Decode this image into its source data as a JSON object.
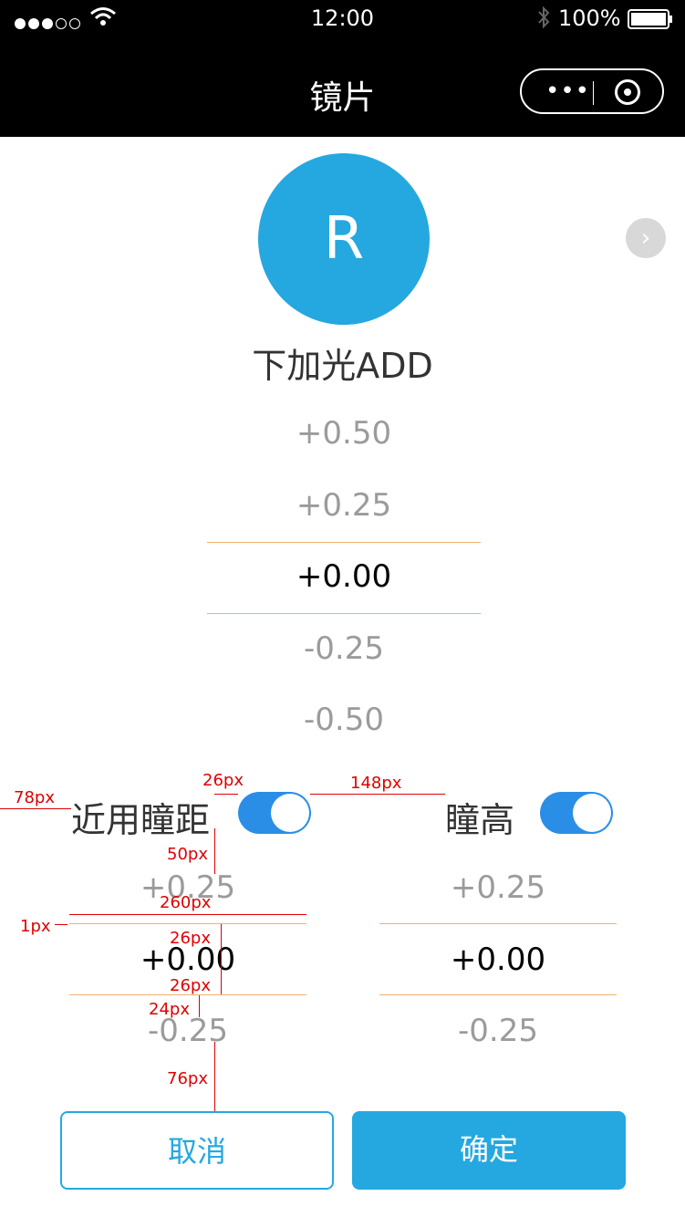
{
  "status": {
    "time": "12:00",
    "battery": "100%"
  },
  "nav": {
    "title": "镜片",
    "more_icon": "more-dots-icon",
    "close_icon": "target-icon"
  },
  "badge": {
    "letter": "R"
  },
  "heading": "下加光ADD",
  "add_picker": {
    "options": [
      "+0.50",
      "+0.25",
      "+0.00",
      "-0.25",
      "-0.50"
    ],
    "selected": "+0.00"
  },
  "near_pd": {
    "label": "近用瞳距",
    "toggle_on": true,
    "options": [
      "+0.25",
      "+0.00",
      "-0.25"
    ],
    "selected": "+0.00"
  },
  "pupil_height": {
    "label": "瞳高",
    "toggle_on": true,
    "options": [
      "+0.25",
      "+0.00",
      "-0.25"
    ],
    "selected": "+0.00"
  },
  "annotations": [
    "78px",
    "26px",
    "148px",
    "50px",
    "260px",
    "1px",
    "26px",
    "26px",
    "24px",
    "76px"
  ],
  "buttons": {
    "cancel": "取消",
    "confirm": "确定"
  },
  "colors": {
    "accent": "#25a8e0",
    "toggle": "#2a8ee6",
    "divider": "#f0b070",
    "annotation": "#e00000"
  }
}
